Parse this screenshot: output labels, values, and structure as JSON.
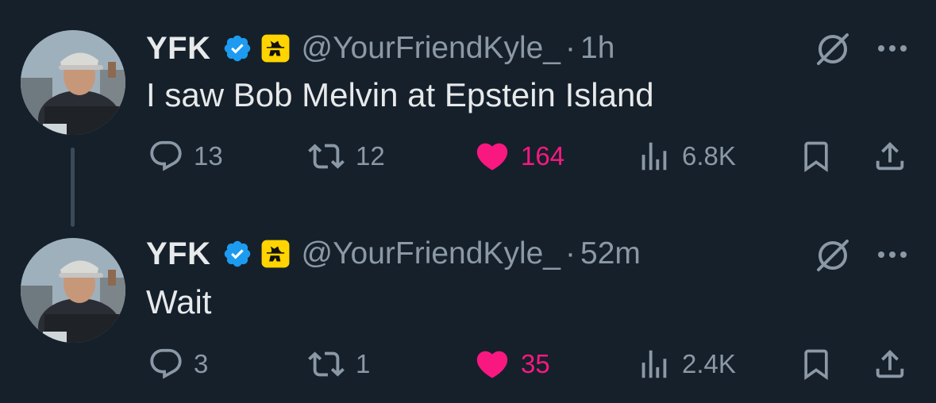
{
  "colors": {
    "background": "#15202b",
    "text": "#e7e9ea",
    "muted": "#8b98a5",
    "like": "#f91880",
    "verified": "#1d9bf0",
    "affiliate_bg": "#ffd400"
  },
  "tweets": [
    {
      "name": "YFK",
      "handle": "@YourFriendKyle_",
      "separator": "·",
      "time": "1h",
      "text": "I saw Bob Melvin at Epstein Island",
      "replies": "13",
      "retweets": "12",
      "likes": "164",
      "views": "6.8K",
      "liked": true
    },
    {
      "name": "YFK",
      "handle": "@YourFriendKyle_",
      "separator": "·",
      "time": "52m",
      "text": "Wait",
      "replies": "3",
      "retweets": "1",
      "likes": "35",
      "views": "2.4K",
      "liked": true
    }
  ],
  "icons": {
    "verified": "verified-badge-icon",
    "affiliate": "affiliate-badge-icon",
    "grok": "grok-icon",
    "more": "more-icon",
    "reply": "reply-icon",
    "retweet": "retweet-icon",
    "like": "heart-icon",
    "views": "views-icon",
    "bookmark": "bookmark-icon",
    "share": "share-icon"
  }
}
